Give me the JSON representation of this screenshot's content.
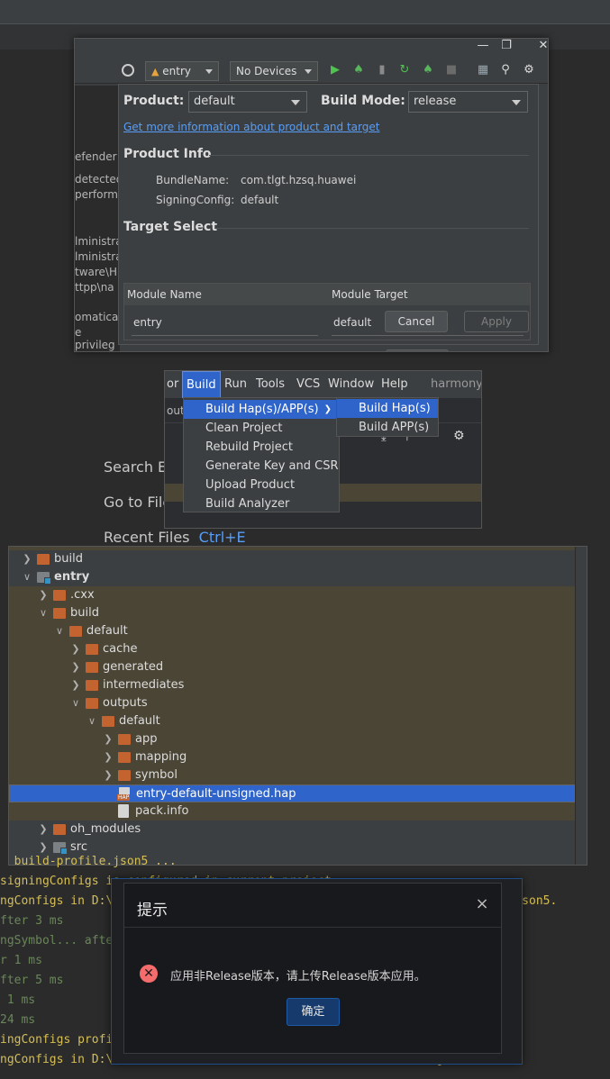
{
  "background_hints": {
    "search_everywhere": "Search Ev",
    "go_to_file": "Go to File",
    "recent_files": "Recent Files",
    "recent_files_shortcut": "Ctrl+E"
  },
  "run_toolbar": {
    "module": "entry",
    "device": "No Devices"
  },
  "left_partial_text": [
    "efender",
    "detected",
    "perform",
    "lministra",
    "lministra",
    "tware\\H",
    "ttpp\\na",
    "omaticall",
    "e privileg"
  ],
  "build_dialog": {
    "product_label": "Product:",
    "product_value": "default",
    "build_mode_label": "Build Mode:",
    "build_mode_value": "release",
    "info_link": "Get more information about product and target",
    "product_info_title": "Product Info",
    "bundle_name_label": "BundleName:",
    "bundle_name_value": "com.tlgt.hzsq.huawei",
    "signing_config_label": "SigningConfig:",
    "signing_config_value": "default",
    "target_select_title": "Target Select",
    "col_module_name": "Module Name",
    "col_module_target": "Module Target",
    "row_module_name": "entry",
    "row_module_target": "default",
    "cancel": "Cancel",
    "apply": "Apply"
  },
  "menubar": {
    "items": [
      "or",
      "Build",
      "Run",
      "Tools",
      "VCS",
      "Window",
      "Help"
    ],
    "project": "harmonyc",
    "partial_left": "outs"
  },
  "build_menu": {
    "items": [
      "Build Hap(s)/APP(s)",
      "Clean Project",
      "Rebuild Project",
      "Generate Key and CSR",
      "Upload Product",
      "Build Analyzer"
    ],
    "submenu": [
      "Build Hap(s)",
      "Build APP(s)"
    ]
  },
  "file_tree": [
    {
      "name": "build",
      "depth": 0,
      "type": "folder",
      "expanded": false
    },
    {
      "name": "entry",
      "depth": 0,
      "type": "module",
      "expanded": true
    },
    {
      "name": ".cxx",
      "depth": 1,
      "type": "folder",
      "expanded": false
    },
    {
      "name": "build",
      "depth": 1,
      "type": "folder",
      "expanded": true
    },
    {
      "name": "default",
      "depth": 2,
      "type": "folder",
      "expanded": true
    },
    {
      "name": "cache",
      "depth": 3,
      "type": "folder",
      "expanded": false
    },
    {
      "name": "generated",
      "depth": 3,
      "type": "folder",
      "expanded": false
    },
    {
      "name": "intermediates",
      "depth": 3,
      "type": "folder",
      "expanded": false
    },
    {
      "name": "outputs",
      "depth": 3,
      "type": "folder",
      "expanded": true
    },
    {
      "name": "default",
      "depth": 4,
      "type": "folder",
      "expanded": true
    },
    {
      "name": "app",
      "depth": 5,
      "type": "folder",
      "expanded": false
    },
    {
      "name": "mapping",
      "depth": 5,
      "type": "folder",
      "expanded": false
    },
    {
      "name": "symbol",
      "depth": 5,
      "type": "folder",
      "expanded": false
    },
    {
      "name": "entry-default-unsigned.hap",
      "depth": 5,
      "type": "hap",
      "selected": true
    },
    {
      "name": "pack.info",
      "depth": 5,
      "type": "file"
    },
    {
      "name": "oh_modules",
      "depth": 1,
      "type": "folder",
      "expanded": false
    },
    {
      "name": "src",
      "depth": 1,
      "type": "folder-gray",
      "expanded": false
    }
  ],
  "console_lines": [
    {
      "text": "  build-profile.json5 ...",
      "style": "y"
    },
    {
      "text": "signingConfigs is configured in current project.",
      "style": "y"
    },
    {
      "text": "ngConfigs in D:\\w...\\git\\ttpp\\native\\engine\\harmonyos-next\\build-profile.json5.",
      "style": "y"
    },
    {
      "text": "fter 3 ms",
      "style": "g"
    },
    {
      "text": "ngSymbol... after 1",
      "style": "g"
    },
    {
      "text": "r 1 ms",
      "style": "g"
    },
    {
      "text": "fter 5 ms",
      "style": "g"
    },
    {
      "text": " 1 ms",
      "style": "g"
    },
    {
      "text": "24 ms",
      "style": "g"
    },
    {
      "text": "ingConfigs profil",
      "style": "y"
    },
    {
      "text": "ngConfigs in D:\\w...                                          json5.",
      "style": "y"
    }
  ],
  "alert": {
    "title": "提示",
    "message": "应用非Release版本，请上传Release版本应用。",
    "ok": "确定",
    "close": "×"
  }
}
